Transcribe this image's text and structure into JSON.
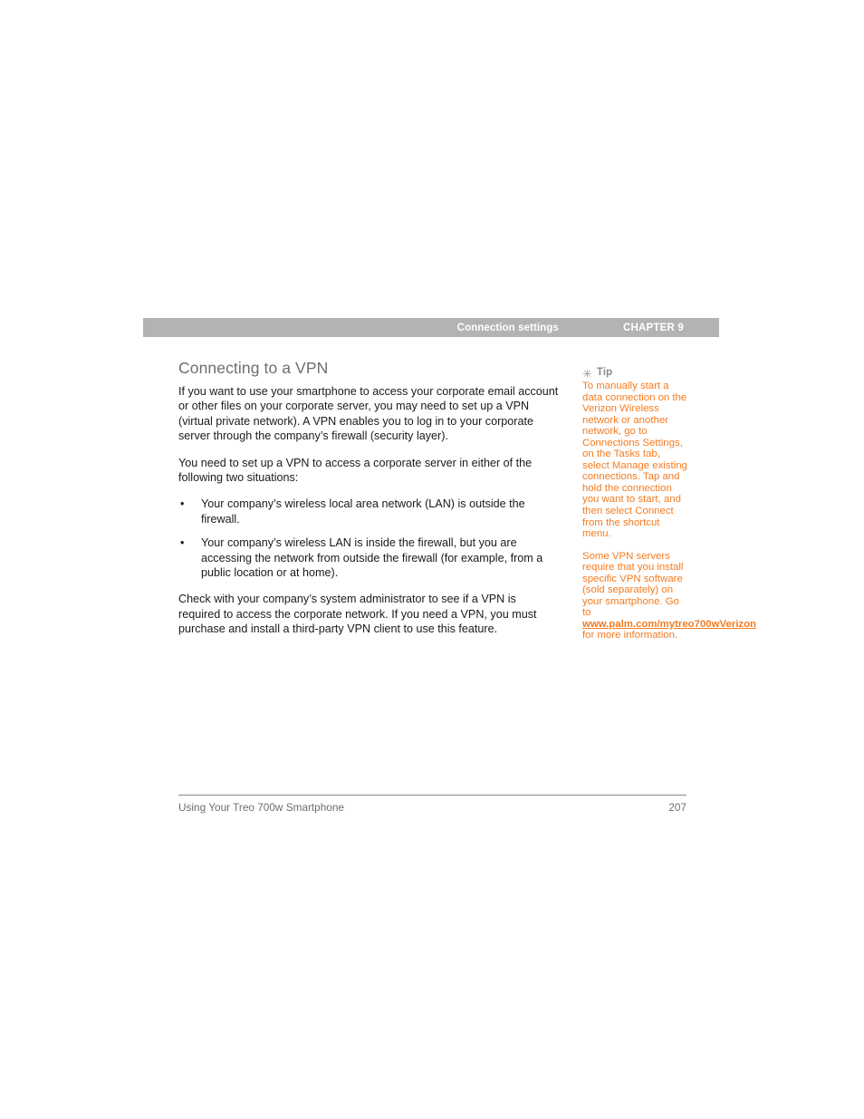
{
  "header": {
    "chapter_title": "Connection settings",
    "chapter_number": "CHAPTER 9",
    "bar_color": "#b3b3b3"
  },
  "main": {
    "heading": "Connecting to a VPN",
    "paragraph_1": "If you want to use your smartphone to access your corporate email account or other files on your corporate server, you may need to set up a VPN (virtual private network). A VPN enables you to log in to your corporate server through the company’s firewall (security layer).",
    "paragraph_2": "You need to set up a VPN to access a corporate server in either of the following two situations:",
    "bullets": [
      {
        "marker": "•",
        "text": "Your company’s wireless local area network (LAN) is outside the firewall."
      },
      {
        "marker": "•",
        "text": "Your company’s wireless LAN is inside the firewall, but you are accessing the network from outside the firewall (for example, from a public location or at home)."
      }
    ],
    "paragraph_3": "Check with your company’s system administrator to see if a VPN is required to access the corporate network. If you need a VPN, you must purchase and install a third-party VPN client to use this feature."
  },
  "tip": {
    "icon": "asterisk-icon",
    "icon_glyph": "✳",
    "label": "Tip",
    "accent_color": "#f47b20",
    "label_color": "#8c8c8c",
    "paragraph_1": "To manually start a data connection on the Verizon Wireless network or another network, go to Connections Settings, on the Tasks tab, select Manage existing connections. Tap and hold the connection you want to start, and then select Connect from the shortcut menu.",
    "paragraph_2_before": "Some VPN servers require that you install specific VPN software (sold separately) on your smartphone. Go to ",
    "paragraph_2_link": "www.palm.com/mytreo700wVerizon",
    "paragraph_2_after": " for more information."
  },
  "footer": {
    "title": "Using Your Treo 700w Smartphone",
    "page_number": "207"
  }
}
